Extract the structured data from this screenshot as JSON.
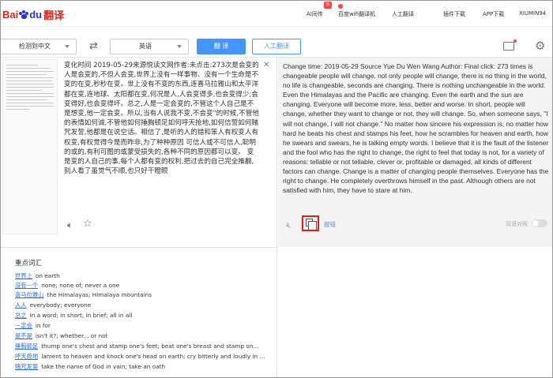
{
  "logo": {
    "bai": "Bai",
    "du": "du",
    "trans": "翻译"
  },
  "nav": [
    {
      "label": "AI同传"
    },
    {
      "label": "百度wifi翻译机"
    },
    {
      "label": "人工翻译"
    },
    {
      "label": "插件下载"
    },
    {
      "label": "APP下载"
    },
    {
      "label": "XIUMIN94"
    }
  ],
  "nav_badge": "热",
  "toolbar": {
    "source_lang": "检测到中文",
    "target_lang": "英语",
    "translate_label": "翻 译",
    "human_label": "人工翻译"
  },
  "source_text": "变化时间 2019-05-29来源悦读文网作者:未点击:273次是会变的人是会变的,不但人会变,世界上没有一样事物、没有一个生命是不变的在变,秒秒在变。世上没有不变的东西,连喜马拉雅山和太平洋都在变,连地球、太阳都在变,何况是人,人会变得多,也会变得少;会变得好,也会变得坏。总之,人是一定会变的,不管这个人自己是不是想变,他一定会变。所以,当有人说我不变,不会变\"的时候,不管他的表情如何诚,不管他如何捶胸顿足如何呼天抢地,如何信誓如何赌咒发誓,他都是在说空话。相信了,是听的人的错和笨人有权变人有权变,有权觉得今是而昨非,为了种种原因 可信人或不可信人,聪明的或的,有利可图的或蒙受损失的,各种不同的原因都可以变。 变是变的人自己的事,每个人都有变的权利,把过去的自己完全推翻,别人看了虽觉气不顺,也只好干瞪眼",
  "target_text": "Change time: 2019-05-29 Source Yue Du Wen Wang Author: Final click: 273 times is changeable people will change, not only people will change, there is no thing in the world, no life is changeable, seconds are changing. There is nothing unchangeable in the world. Even the Himalayas and the Pacific are changing. Even the earth and the sun are changing. Everyone will become more, less, better and worse. In short, people will change, whether they want to change or not, they will change. So, when someone says, \"I will not change, I will not change.\" No matter how sincere his expression is, no matter how hard he beats his chest and stamps his feet, how he scrambles for heaven and earth, how he swears and swears, he is talking empty words. I believe that it is the fault of the listener and the fool who has the right to change, the right to feel that today is not, for a variety of reasons: tellable or not tellable, clever or, profitable or damaged, all kinds of different factors can change. Change is a matter of changing people themselves. Everyone has the right to change. He completely overthrows himself in the past. Although others are not satisfied with him, they have to stare at him.",
  "result_toolbar": {
    "report": "报错",
    "compare": "双语对照"
  },
  "vocab": {
    "title": "重点词汇",
    "items": [
      {
        "term": "世界上",
        "def": "on earth"
      },
      {
        "term": "没有一个",
        "def": "none; none of; never a one"
      },
      {
        "term": "喜马拉雅山",
        "def": "the Himalayas; Himalaya mountains"
      },
      {
        "term": "人人",
        "def": "everybody; everyone"
      },
      {
        "term": "总之",
        "def": "in a word; in short; in brief; all in all"
      },
      {
        "term": "一定会",
        "def": "in for"
      },
      {
        "term": "是不是",
        "def": "isn't it?; whether... or not"
      },
      {
        "term": "捶胸顿足",
        "def": "thump one's chest and stamp one's feet; beat one's breast and stamp on..."
      },
      {
        "term": "呼天抢地",
        "def": "lament to heaven and knock one's head on earth; cry bitterly and loudly in ..."
      },
      {
        "term": "赌咒发誓",
        "def": "take the name of God in vain; take an oath"
      }
    ]
  }
}
